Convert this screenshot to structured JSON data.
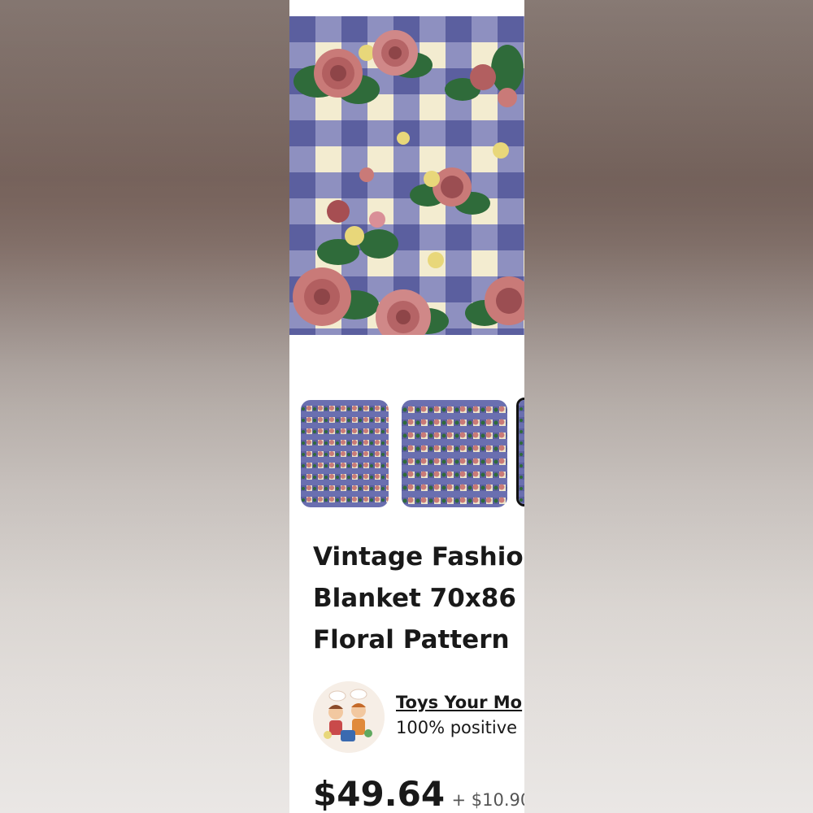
{
  "listing": {
    "title_lines": [
      "Vintage Fashio",
      "Blanket 70x86",
      "Floral Pattern"
    ],
    "images": {
      "thumbnail_count": 3,
      "selected_thumbnail_index": 2
    }
  },
  "seller": {
    "name": "Toys Your Mo",
    "feedback": "100% positive"
  },
  "pricing": {
    "price": "$49.64",
    "shipping": "+ $10.90"
  },
  "colors": {
    "plaid_blue": "#6a6fb0",
    "plaid_cream": "#f3ecd0",
    "rose_pink": "#c97a78",
    "leaf_green": "#2f6b3a",
    "flower_yellow": "#e8d77a",
    "text": "#191919"
  }
}
